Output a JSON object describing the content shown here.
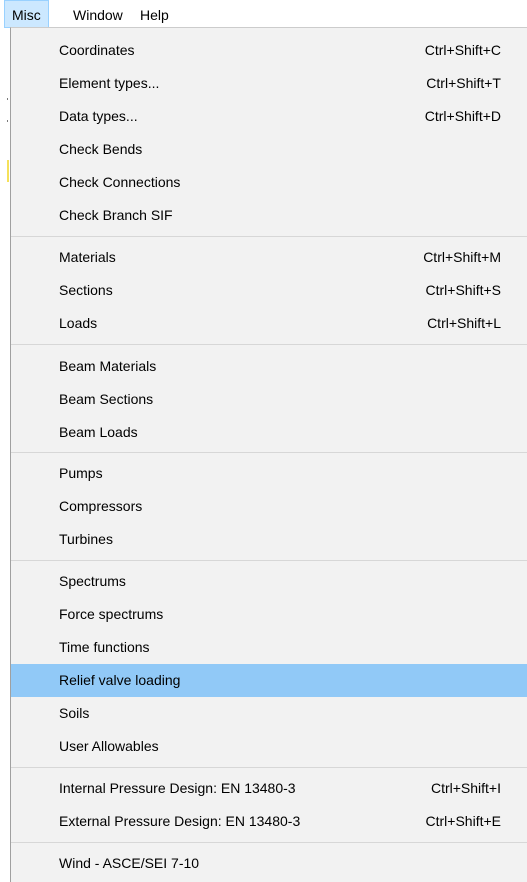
{
  "menubar": {
    "items": [
      {
        "label": "Misc",
        "active": true
      },
      {
        "label": "Window",
        "active": false
      },
      {
        "label": "Help",
        "active": false
      }
    ]
  },
  "menu": {
    "items": [
      {
        "label": "Coordinates",
        "shortcut": "Ctrl+Shift+C"
      },
      {
        "label": "Element types...",
        "shortcut": "Ctrl+Shift+T"
      },
      {
        "label": "Data types...",
        "shortcut": "Ctrl+Shift+D"
      },
      {
        "label": "Check Bends",
        "shortcut": ""
      },
      {
        "label": "Check Connections",
        "shortcut": ""
      },
      {
        "label": "Check Branch SIF",
        "shortcut": ""
      },
      {
        "label": "Materials",
        "shortcut": "Ctrl+Shift+M"
      },
      {
        "label": "Sections",
        "shortcut": "Ctrl+Shift+S"
      },
      {
        "label": "Loads",
        "shortcut": "Ctrl+Shift+L"
      },
      {
        "label": "Beam Materials",
        "shortcut": ""
      },
      {
        "label": "Beam Sections",
        "shortcut": ""
      },
      {
        "label": "Beam Loads",
        "shortcut": ""
      },
      {
        "label": "Pumps",
        "shortcut": ""
      },
      {
        "label": "Compressors",
        "shortcut": ""
      },
      {
        "label": "Turbines",
        "shortcut": ""
      },
      {
        "label": "Spectrums",
        "shortcut": ""
      },
      {
        "label": "Force spectrums",
        "shortcut": ""
      },
      {
        "label": "Time functions",
        "shortcut": ""
      },
      {
        "label": "Relief valve loading",
        "shortcut": "",
        "highlighted": true
      },
      {
        "label": "Soils",
        "shortcut": ""
      },
      {
        "label": "User Allowables",
        "shortcut": ""
      },
      {
        "label": "Internal Pressure Design: EN 13480-3",
        "shortcut": "Ctrl+Shift+I"
      },
      {
        "label": "External Pressure Design: EN 13480-3",
        "shortcut": "Ctrl+Shift+E"
      },
      {
        "label": "Wind - ASCE/SEI 7-10",
        "shortcut": ""
      }
    ]
  },
  "colors": {
    "menu_background": "#f2f2f2",
    "highlight": "#91c9f7",
    "menubar_active": "#cce8ff",
    "separator": "#d7d7d7"
  }
}
